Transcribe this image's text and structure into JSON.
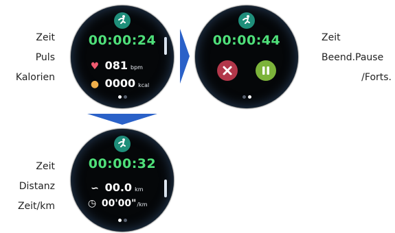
{
  "colors": {
    "arrow": "#2a61c8",
    "time_text": "#4fe07a",
    "run_badge": "#1f8f7a",
    "cancel_button": "#b2374a",
    "pause_button": "#7cb33a"
  },
  "screen1": {
    "labels": [
      "Zeit",
      "Puls",
      "Kalorien"
    ],
    "time": "00:00:24",
    "pulse_value": "081",
    "pulse_unit": "bpm",
    "calories_value": "0000",
    "calories_unit": "kcal",
    "icons": [
      "runner-icon",
      "heart-icon",
      "flame-icon"
    ]
  },
  "screen2": {
    "labels": [
      "Zeit",
      "Beend.Pause",
      "/Forts."
    ],
    "time": "00:00:44",
    "icons": [
      "runner-icon",
      "close-icon",
      "pause-icon"
    ]
  },
  "screen3": {
    "labels": [
      "Zeit",
      "Distanz",
      "Zeit/km"
    ],
    "time": "00:00:32",
    "distance_value": "00.0",
    "distance_unit": "km",
    "pace_value": "00'00\"",
    "pace_unit": "/km",
    "icons": [
      "runner-icon",
      "distance-icon",
      "pace-icon"
    ]
  }
}
